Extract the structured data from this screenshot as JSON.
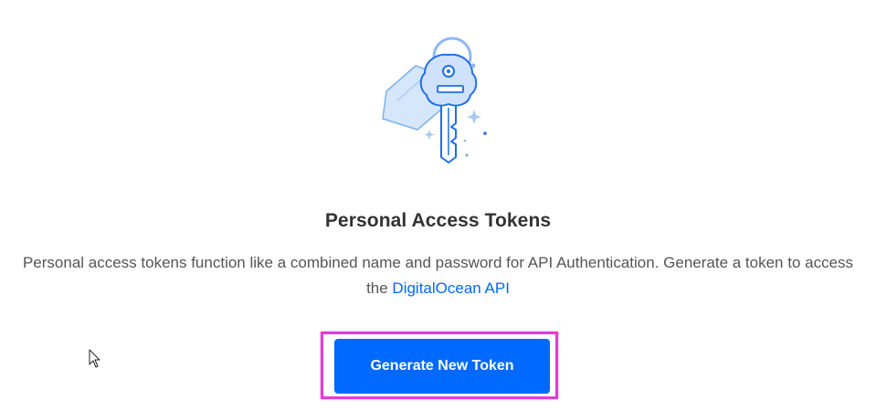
{
  "illustration": {
    "icon": "key-with-tag-icon"
  },
  "heading": {
    "title": "Personal Access Tokens"
  },
  "description": {
    "text": "Personal access tokens function like a combined name and password for API Authentication. Generate a token to access the ",
    "link_label": "DigitalOcean API"
  },
  "actions": {
    "generate_label": "Generate New Token"
  },
  "colors": {
    "accent": "#0069ff",
    "highlight": "#e53bd8",
    "title": "#333333",
    "body_text": "#555555"
  }
}
